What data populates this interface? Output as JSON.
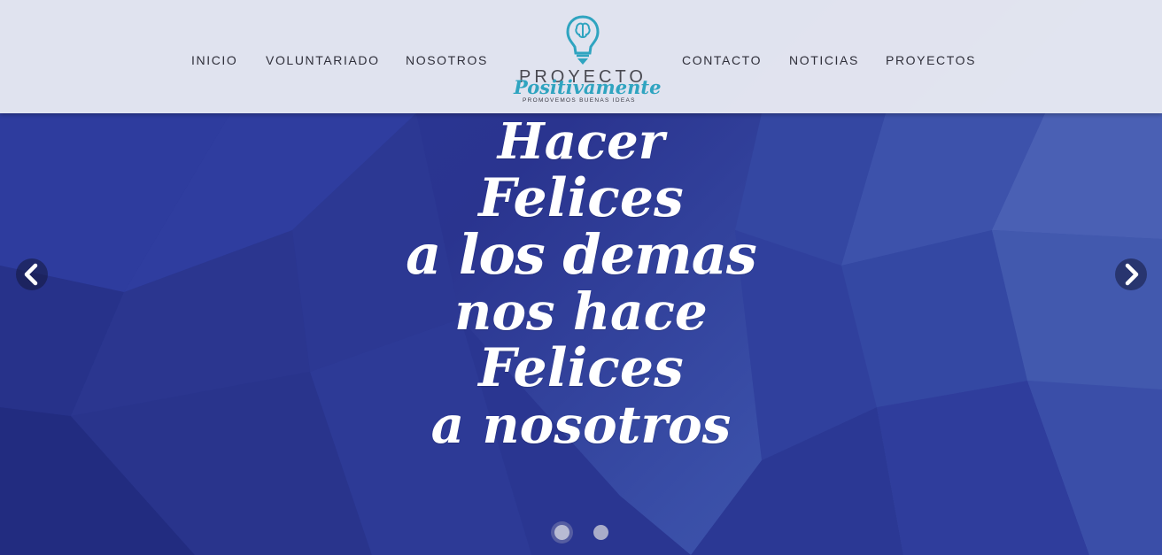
{
  "nav": {
    "left": [
      "INICIO",
      "VOLUNTARIADO",
      "NOSOTROS"
    ],
    "right": [
      "CONTACTO",
      "NOTICIAS",
      "PROYECTOS"
    ]
  },
  "logo": {
    "word1": "PROYECTO",
    "word2": "Positivamente",
    "tagline": "PROMOVEMOS BUENAS IDEAS",
    "icon": "lightbulb-brain-icon",
    "accent_color": "#2fa4c0"
  },
  "hero": {
    "slogan_lines": [
      "Hacer",
      "Felices",
      "a los demas",
      "nos hace",
      "Felices",
      "a nosotros"
    ],
    "background_color": "#2c3a9a",
    "prev_icon": "chevron-left-icon",
    "next_icon": "chevron-right-icon",
    "slides_total": 2,
    "active_slide": 1
  }
}
